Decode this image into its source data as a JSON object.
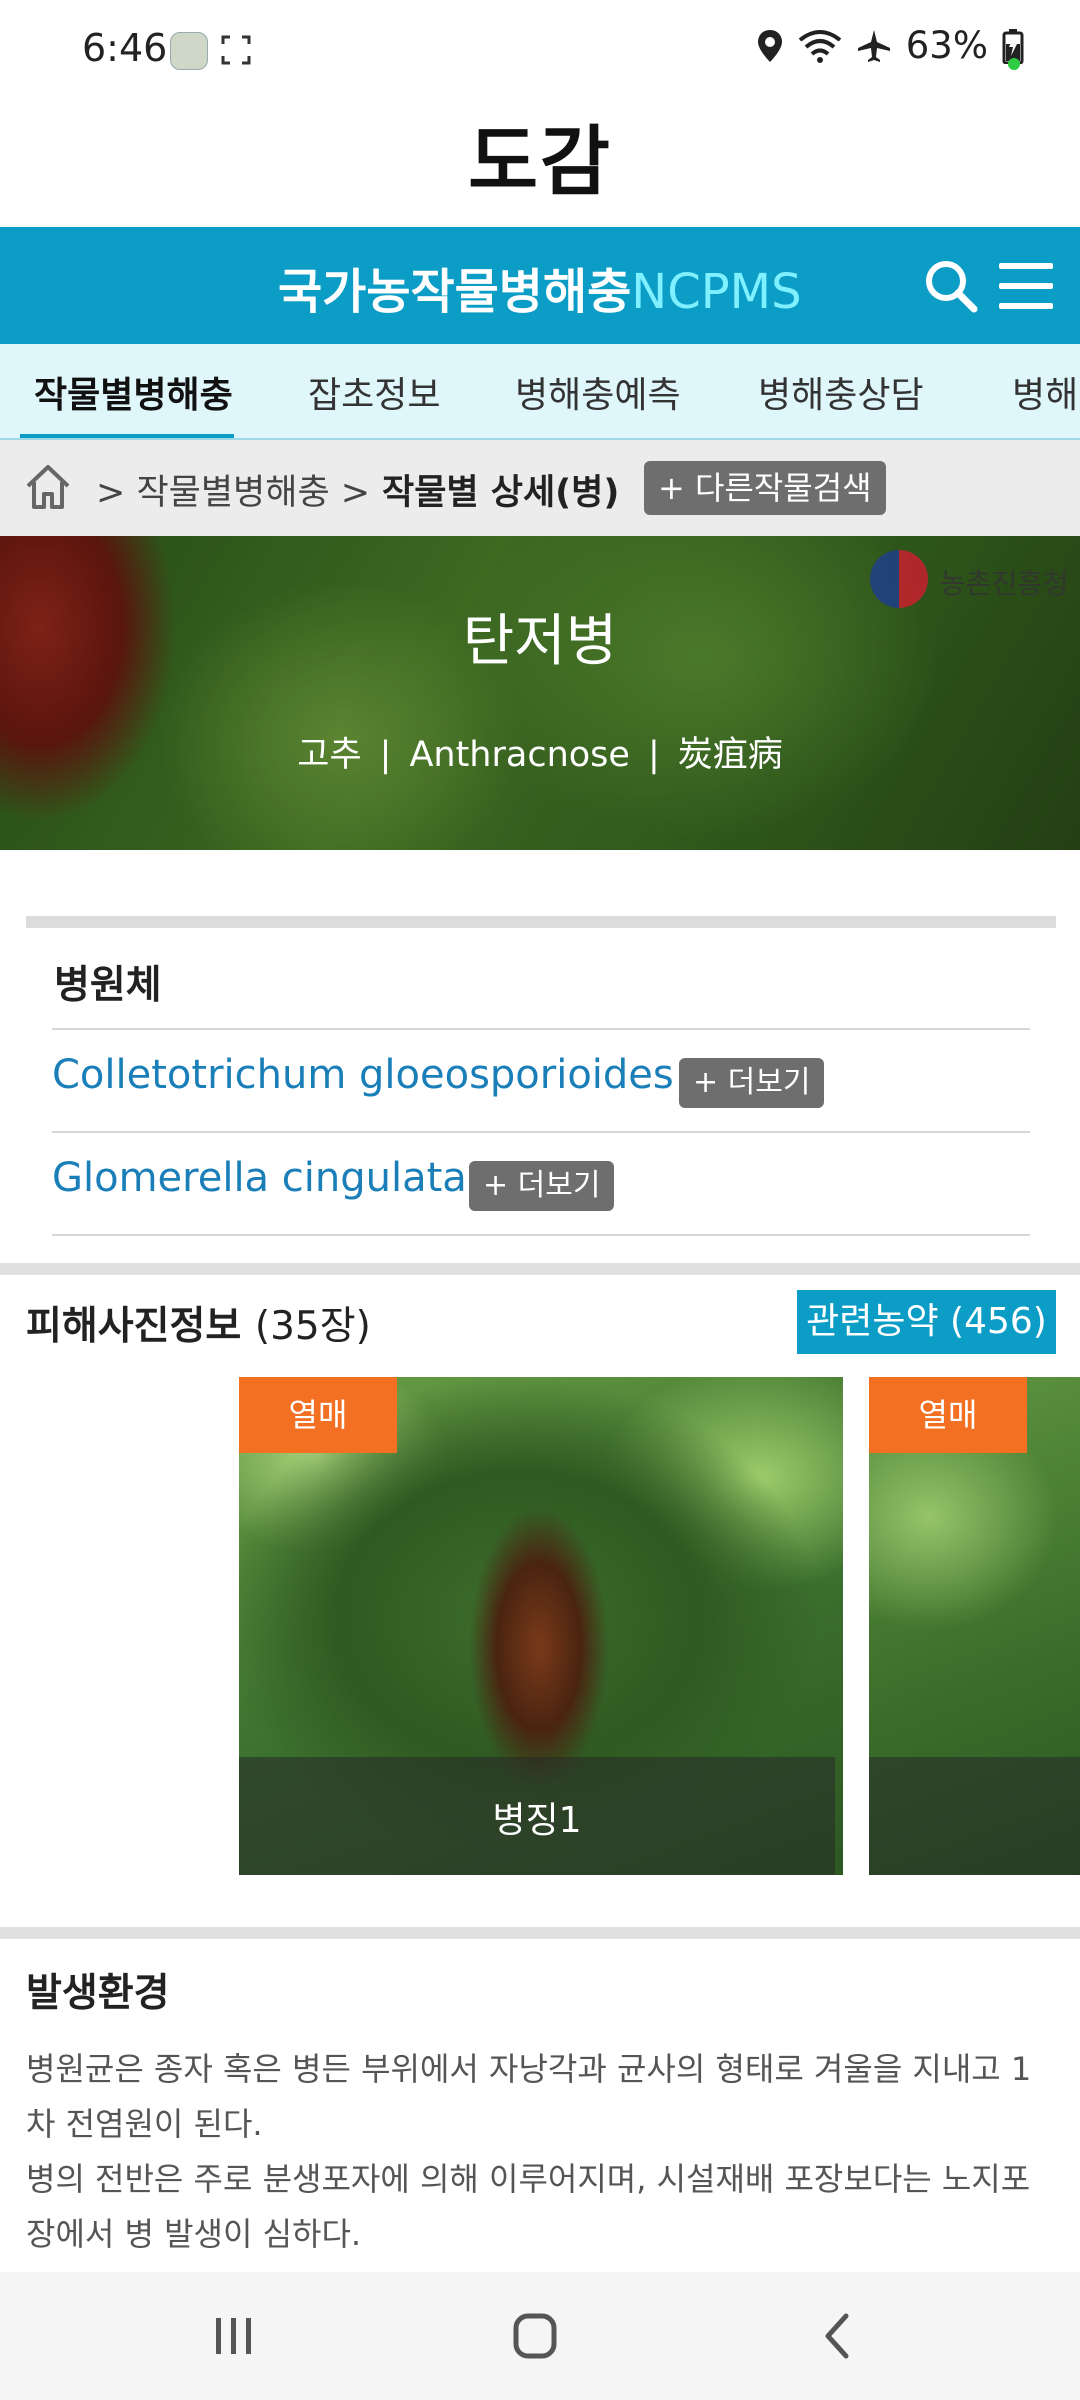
{
  "status_bar": {
    "time": "6:46",
    "battery": "63%",
    "icons": [
      "app-badge-icon",
      "fullscreen-icon",
      "location-icon",
      "wifi-icon",
      "airplane-icon",
      "battery-icon"
    ]
  },
  "app_title": "도감",
  "site_header": {
    "brand_korean": "국가농작물병해충",
    "brand_english": "NCPMS",
    "color": "#0b9dc6"
  },
  "tabs": [
    {
      "label": "작물별병해충",
      "active": true
    },
    {
      "label": "잡초정보",
      "active": false
    },
    {
      "label": "병해충예측",
      "active": false
    },
    {
      "label": "병해충상담",
      "active": false
    },
    {
      "label": "병해충",
      "active": false
    }
  ],
  "breadcrumb": {
    "items": [
      "> 작물별병해충 >",
      "작물별 상세(병)"
    ],
    "other_search_label": "+ 다른작물검색"
  },
  "hero": {
    "title": "탄저병",
    "crop": "고추",
    "english_name": "Anthracnose",
    "chinese_name": "炭疽病",
    "separator": "|",
    "logo_text": "농촌진흥청"
  },
  "pathogen": {
    "heading": "병원체",
    "items": [
      {
        "name": "Colletotrichum gloeosporioides",
        "more_label": "+ 더보기"
      },
      {
        "name": "Glomerella cingulata",
        "more_label": "+ 더보기"
      }
    ]
  },
  "photos": {
    "heading": "피해사진정보",
    "count": "(35장)",
    "pesticide_button": "관련농약 (456)",
    "items": [
      {
        "tag": "열매",
        "caption": "병징1"
      },
      {
        "tag": "열매",
        "caption": ""
      }
    ],
    "tag_color": "#f36f21"
  },
  "environment": {
    "heading": "발생환경",
    "paragraphs": [
      "병원균은 종자 혹은 병든 부위에서 자낭각과 균사의 형태로 겨울을 지내고 1차 전염원이 된다.",
      "병의 전반은 주로 분생포자에 의해 이루어지며, 시설재배 포장보다는 노지포장에서 병 발생이 심하다."
    ]
  },
  "nav_bar": {
    "buttons": [
      "recent-apps-icon",
      "home-icon",
      "back-icon"
    ]
  }
}
